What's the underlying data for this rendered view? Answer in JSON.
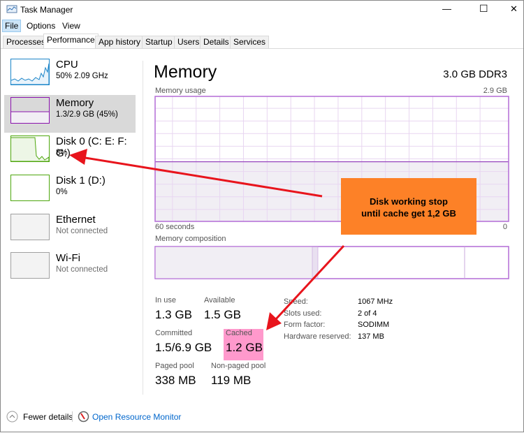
{
  "window": {
    "title": "Task Manager",
    "minimize": "—",
    "maximize": "☐",
    "close": "✕"
  },
  "menu": [
    "File",
    "Options",
    "View"
  ],
  "tabs": [
    "Processes",
    "Performance",
    "App history",
    "Startup",
    "Users",
    "Details",
    "Services"
  ],
  "sidebar": [
    {
      "name": "CPU",
      "sub": "50% 2.09 GHz",
      "color": "#1a84c8"
    },
    {
      "name": "Memory",
      "sub": "1.3/2.9 GB (45%)",
      "color": "#8b12ae"
    },
    {
      "name": "Disk 0 (C: E: F: G:)",
      "sub": "8%",
      "color": "#4da60c"
    },
    {
      "name": "Disk 1 (D:)",
      "sub": "0%",
      "color": "#4da60c"
    },
    {
      "name": "Ethernet",
      "sub": "Not connected",
      "color": "#a0a0a0"
    },
    {
      "name": "Wi-Fi",
      "sub": "Not connected",
      "color": "#a0a0a0"
    }
  ],
  "main": {
    "title": "Memory",
    "spec": "3.0 GB DDR3",
    "usage_label": "Memory usage",
    "usage_max": "2.9 GB",
    "time_left": "60 seconds",
    "time_right": "0",
    "usage_fraction": 0.45,
    "composition_label": "Memory composition",
    "stats": {
      "in_use_label": "In use",
      "in_use": "1.3 GB",
      "available_label": "Available",
      "available": "1.5 GB",
      "committed_label": "Committed",
      "committed": "1.5/6.9 GB",
      "cached_label": "Cached",
      "cached": "1.2 GB",
      "paged_label": "Paged pool",
      "paged": "338 MB",
      "nonpaged_label": "Non-paged pool",
      "nonpaged": "119 MB"
    },
    "details": [
      {
        "k": "Speed:",
        "v": "1067 MHz"
      },
      {
        "k": "Slots used:",
        "v": "2 of 4"
      },
      {
        "k": "Form factor:",
        "v": "SODIMM"
      },
      {
        "k": "Hardware reserved:",
        "v": "137 MB"
      }
    ]
  },
  "annotation": {
    "line1": "Disk working stop",
    "line2": "until cache get 1,2 GB",
    "box_color": "#fd8127",
    "highlight_color": "#ff99cc",
    "arrow_color": "#e8141c"
  },
  "footer": {
    "fewer": "Fewer details",
    "monitor": "Open Resource Monitor"
  }
}
